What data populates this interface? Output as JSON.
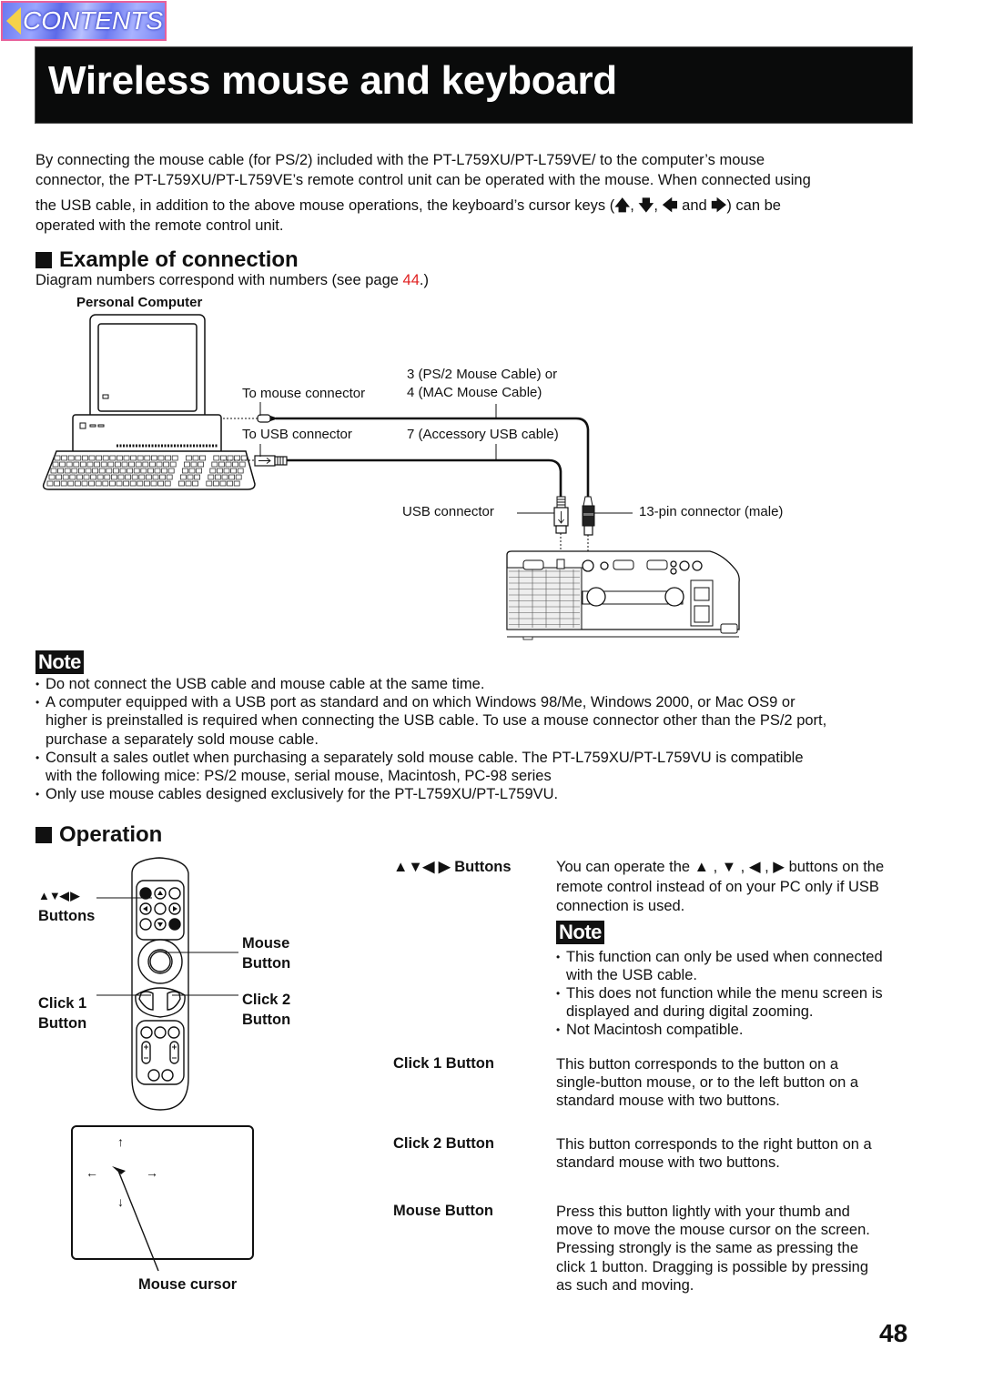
{
  "nav": {
    "contents_label": "CONTENTS"
  },
  "header": {
    "title": "Wireless mouse and keyboard"
  },
  "intro": {
    "line1": "By connecting the mouse cable (for PS/2) included with the PT-L759XU/PT-L759VE/ to the computer’s mouse",
    "line2": "connector, the PT-L759XU/PT-L759VE’s remote control unit can be operated with the mouse.  When connected using",
    "line3_prefix": "the USB cable, in addition to the above mouse operations, the keyboard’s cursor keys (",
    "arrow_up": "🡅",
    "arrow_down": "🡇",
    "arrow_left": "🡄",
    "arrow_right": "🡆",
    "sep": ", ",
    "and": " and ",
    "line3_suffix": ") can be",
    "line4": "operated with the remote control unit."
  },
  "example": {
    "heading": "Example of connection",
    "caption_prefix": "Diagram numbers correspond with numbers (see page ",
    "caption_link": "44",
    "caption_suffix": ".)",
    "diagram": {
      "pc_label": "Personal  Computer",
      "to_mouse_connector": "To mouse connector",
      "to_usb_connector": "To USB connector",
      "cable_ps2_line1": "3 (PS/2 Mouse Cable) or",
      "cable_ps2_line2": "4 (MAC Mouse Cable)",
      "cable_usb": "7 (Accessory USB cable)",
      "usb_connector": "USB connector",
      "pin_connector": "13-pin connector (male)"
    }
  },
  "note": {
    "badge": "Note",
    "items": [
      [
        "Do not connect the USB cable and mouse cable at the same time."
      ],
      [
        "A computer equipped with a USB port as standard and on which Windows 98/Me, Windows 2000, or Mac OS9 or",
        "higher is preinstalled is required when connecting the USB cable. To use a mouse connector other than the PS/2 port,",
        "purchase a separately sold mouse cable."
      ],
      [
        "Consult a sales outlet when purchasing a separately sold mouse cable.  The PT-L759XU/PT-L759VU is compatible",
        "with the following mice: PS/2 mouse, serial mouse, Macintosh, PC-98 series"
      ],
      [
        "Only use mouse cables designed exclusively for the PT-L759XU/PT-L759VU."
      ]
    ]
  },
  "operation": {
    "heading": "Operation",
    "remote_labels": {
      "arrows": "▲▼◀ ▶",
      "buttons": "Buttons",
      "mouse_line1": "Mouse",
      "mouse_line2": "Button",
      "click1_line1": "Click 1",
      "click1_line2": "Button",
      "click2_line1": "Click 2",
      "click2_line2": "Button"
    },
    "screen": {
      "up": "↑",
      "down": "↓",
      "left": "←",
      "right": "→",
      "cursor_label": "Mouse cursor"
    },
    "rows": [
      {
        "term": "▲▼◀ ▶ Buttons",
        "desc": [
          "You can operate the ▲ , ▼ , ◀ , ▶ buttons on the",
          "remote control instead of on your PC only if USB",
          "connection is used."
        ],
        "note_badge": "Note",
        "notes": [
          [
            "This function can only be used when connected",
            "with the USB cable."
          ],
          [
            "This does not function while the menu screen is",
            "displayed and during digital zooming."
          ],
          [
            "Not Macintosh compatible."
          ]
        ]
      },
      {
        "term": "Click 1 Button",
        "desc": [
          "This button corresponds to the button on a",
          "single-button mouse, or to the left button on a",
          "standard mouse with two buttons."
        ]
      },
      {
        "term": "Click 2 Button",
        "desc": [
          "This button corresponds to the right button on a",
          "standard mouse with two buttons."
        ]
      },
      {
        "term": "Mouse Button",
        "desc": [
          "Press this button lightly with your thumb and",
          "move to move the mouse cursor on the screen.",
          "Pressing strongly is the same as pressing the",
          "click 1 button.  Dragging is possible by pressing",
          "as such and moving."
        ]
      }
    ]
  },
  "footer": {
    "page_number": "48"
  }
}
